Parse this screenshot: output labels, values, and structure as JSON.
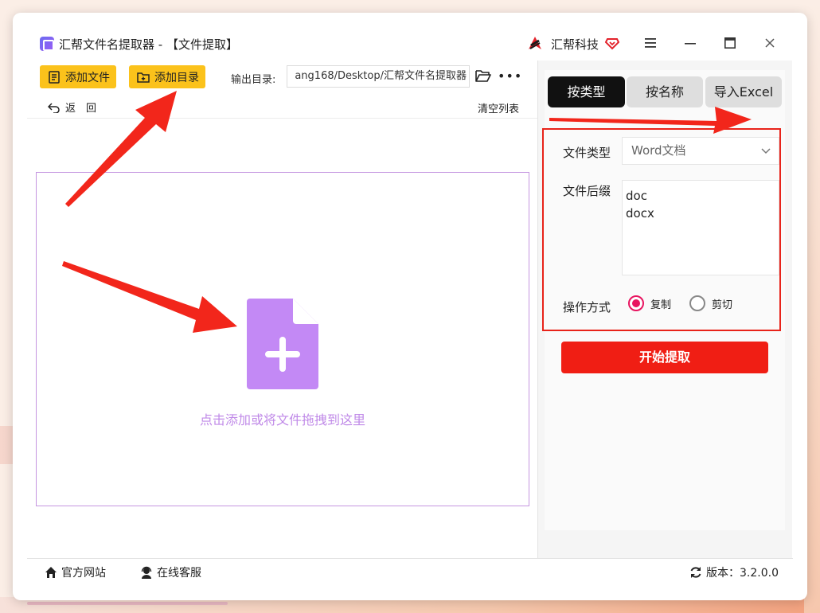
{
  "app": {
    "title": "汇帮文件名提取器 - 【文件提取】",
    "brand": "汇帮科技"
  },
  "toolbar": {
    "add_file": "添加文件",
    "add_dir": "添加目录",
    "output_label": "输出目录:",
    "output_path": "ang168/Desktop/汇帮文件名提取器",
    "more": "•••",
    "back": "返　回",
    "clear_list": "清空列表"
  },
  "dropzone": {
    "hint": "点击添加或将文件拖拽到这里"
  },
  "tabs": [
    {
      "label": "按类型",
      "active": true
    },
    {
      "label": "按名称",
      "active": false
    },
    {
      "label": "导入Excel",
      "active": false
    }
  ],
  "settings": {
    "file_type_label": "文件类型",
    "file_type_value": "Word文档",
    "suffix_label": "文件后缀",
    "suffixes": [
      "doc",
      "docx"
    ],
    "operation_label": "操作方式",
    "op_copy": "复制",
    "op_cut": "剪切",
    "selected_operation": "复制"
  },
  "start_button": "开始提取",
  "footer": {
    "website": "官方网站",
    "service": "在线客服",
    "version": "版本：3.2.0.0"
  },
  "colors": {
    "toolbar_button": "#fbc21b",
    "active_tab": "#111111",
    "start_button": "#f01e14",
    "highlight_box": "#e8231a",
    "dropzone_accent": "#c08ae8",
    "radio_selected": "#e81560",
    "annotation_arrow": "#f2261b"
  }
}
